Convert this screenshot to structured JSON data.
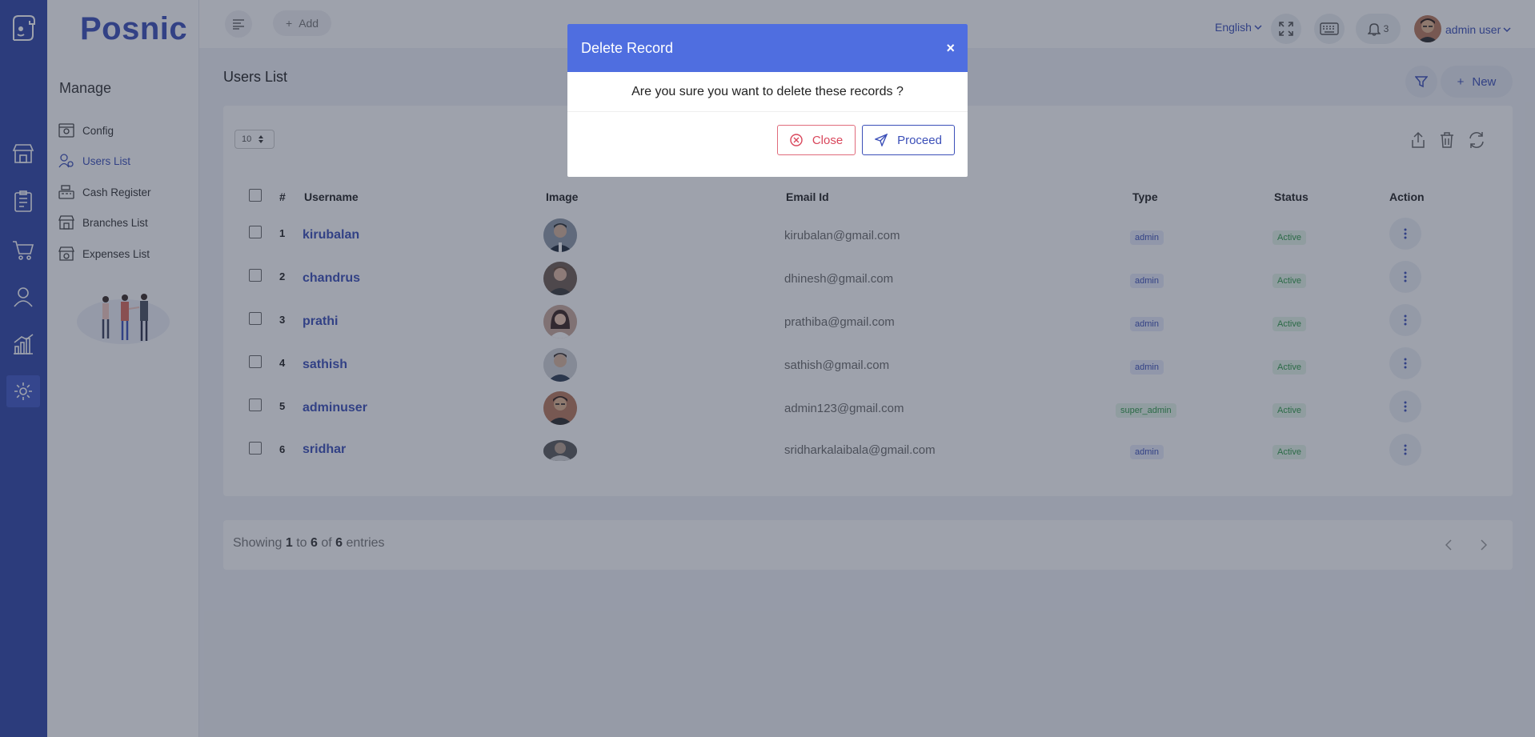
{
  "app": {
    "brand": "Posnic"
  },
  "topbar": {
    "add_label": "Add",
    "language": "English",
    "notification_count": "3",
    "user_name": "admin user"
  },
  "sidebar": {
    "section_title": "Manage",
    "items": [
      {
        "label": "Config",
        "icon": "config-icon",
        "active": false
      },
      {
        "label": "Users List",
        "icon": "users-icon",
        "active": true
      },
      {
        "label": "Cash Register",
        "icon": "cash-register-icon",
        "active": false
      },
      {
        "label": "Branches List",
        "icon": "branches-icon",
        "active": false
      },
      {
        "label": "Expenses List",
        "icon": "expenses-icon",
        "active": false
      }
    ]
  },
  "rail": {
    "items": [
      "store-icon",
      "clipboard-icon",
      "cart-icon",
      "user-icon",
      "chart-icon",
      "settings-icon"
    ],
    "active": "settings-icon"
  },
  "page": {
    "title": "Users List",
    "new_label": "New",
    "page_size": "10"
  },
  "table": {
    "headers": {
      "num": "#",
      "username": "Username",
      "image": "Image",
      "email": "Email Id",
      "type": "Type",
      "status": "Status",
      "action": "Action"
    },
    "rows": [
      {
        "num": "1",
        "username": "kirubalan",
        "email": "kirubalan@gmail.com",
        "type": "admin",
        "status": "Active"
      },
      {
        "num": "2",
        "username": "chandrus",
        "email": "dhinesh@gmail.com",
        "type": "admin",
        "status": "Active"
      },
      {
        "num": "3",
        "username": "prathi",
        "email": "prathiba@gmail.com",
        "type": "admin",
        "status": "Active"
      },
      {
        "num": "4",
        "username": "sathish",
        "email": "sathish@gmail.com",
        "type": "admin",
        "status": "Active"
      },
      {
        "num": "5",
        "username": "adminuser",
        "email": "admin123@gmail.com",
        "type": "super_admin",
        "status": "Active"
      },
      {
        "num": "6",
        "username": "sridhar",
        "email": "sridharkalaibala@gmail.com",
        "type": "admin",
        "status": "Active"
      }
    ]
  },
  "footer": {
    "showing_prefix": "Showing",
    "from": "1",
    "to_word": "to",
    "to": "6",
    "of_word": "of",
    "total": "6",
    "suffix": "entries"
  },
  "modal": {
    "title": "Delete Record",
    "close_x": "×",
    "message": "Are you sure you want to delete these records ?",
    "close_label": "Close",
    "proceed_label": "Proceed"
  },
  "colors": {
    "primary": "#3b4fb8",
    "rail": "#3046a8",
    "modal_header": "#4f6ee0",
    "danger": "#d9465b",
    "success": "#2f9a48"
  }
}
